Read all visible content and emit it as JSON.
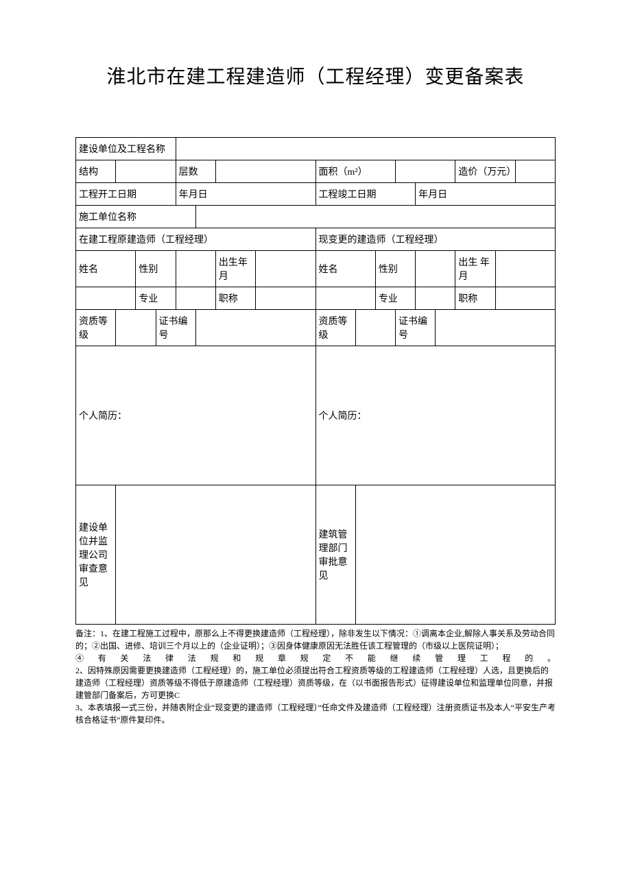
{
  "title": "淮北市在建工程建造师（工程经理）变更备案表",
  "row1": {
    "label": "建设单位及工程名称"
  },
  "row2": {
    "structure_label": "结构",
    "floors_label": "层数",
    "area_label": "面积（m²）",
    "cost_label": "造价（万元）"
  },
  "row3": {
    "start_label": "工程开工日期",
    "start_value": "年月日",
    "end_label": "工程竣工日期",
    "end_value": "年月日"
  },
  "row4": {
    "contractor_label": "施工单位名称"
  },
  "row5": {
    "original_header": "在建工程原建造师（工程经理）",
    "new_header": "现变更的建造师（工程经理）"
  },
  "person": {
    "name": "姓名",
    "gender": "性别",
    "birth": "出生年月",
    "birth2": "出生 年月",
    "major": "专业",
    "title": "职称",
    "qual_level": "资质等级",
    "cert_no": "证书编号",
    "resume": "个人简历："
  },
  "opinion": {
    "left": "建设单位并监理公司审查意见",
    "right": "建筑管理部门审批意见"
  },
  "notes": {
    "line0": "备注：1、在建工程施工过程中，原那么上不得更换建造师（工程经理），除非发生以下情况：①调离本企业,解除人事关系及劳动合同的；②出国、进修、培训三个月以上的（企业证明）；③因身体健康原因无法胜任该工程管理的（市级以上医院证明）；",
    "line1": "④ 有 关 法 律 法 规 和 规 章 规 定 不 能 继 续 管 理 工 程 的 。",
    "line2": "2、因特殊原因需要更换建造师（工程经理）的，施工单位必须提出符合工程资质等级的工程建造师（工程经理）人选，且更换后的建造师（工程经理）资质等级不得低于原建造师（工程经理）资质等级，在（以书面报告形式）征得建设单位和监理单位同意，并报建管部门备案后，方可更换C",
    "line3": "3、本表填报一式三份，并随表附企业“现变更的建造师（工程经理）”任命文件及建造师（工程经理）注册资质证书及本人“平安生产考核合格证书”原件复印件。"
  }
}
